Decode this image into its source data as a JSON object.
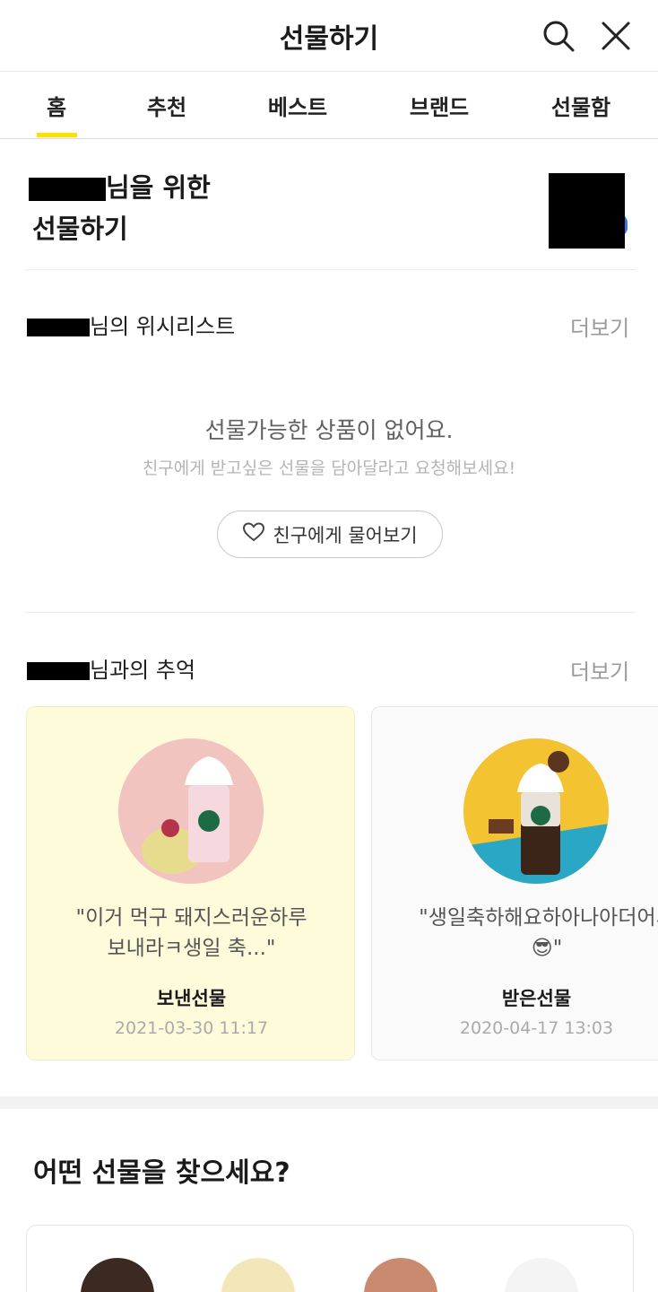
{
  "header": {
    "title": "선물하기",
    "search_icon": "search-icon",
    "close_icon": "close-icon"
  },
  "tabs": [
    {
      "label": "홈",
      "active": true
    },
    {
      "label": "추천"
    },
    {
      "label": "베스트"
    },
    {
      "label": "브랜드"
    },
    {
      "label": "선물함"
    }
  ],
  "hero": {
    "line1_suffix": "님을 위한",
    "line2": "선물하기"
  },
  "wishlist": {
    "title_suffix": "님의 위시리스트",
    "more": "더보기",
    "empty_main": "선물가능한 상품이 없어요.",
    "empty_sub": "친구에게 받고싶은 선물을 담아달라고 요청해보세요!",
    "ask_button": "친구에게 물어보기"
  },
  "memories": {
    "title_suffix": "님과의 추억",
    "more": "더보기",
    "cards": [
      {
        "message_line1": "\"이거 먹구 돼지스러운하루",
        "message_line2": "보내라ㅋ생일 축...\"",
        "kind": "보낸선물",
        "date": "2021-03-30 11:17"
      },
      {
        "message_line1": "\"생일축하해요하아나아더어서",
        "message_line2": "😎\"",
        "kind": "받은선물",
        "date": "2020-04-17 13:03"
      }
    ]
  },
  "find": {
    "title": "어떤 선물을 찾으세요?"
  },
  "colors": {
    "accent": "#ffe100",
    "sent_card_bg": "#fefbdb",
    "muted": "#9a9a9a"
  }
}
